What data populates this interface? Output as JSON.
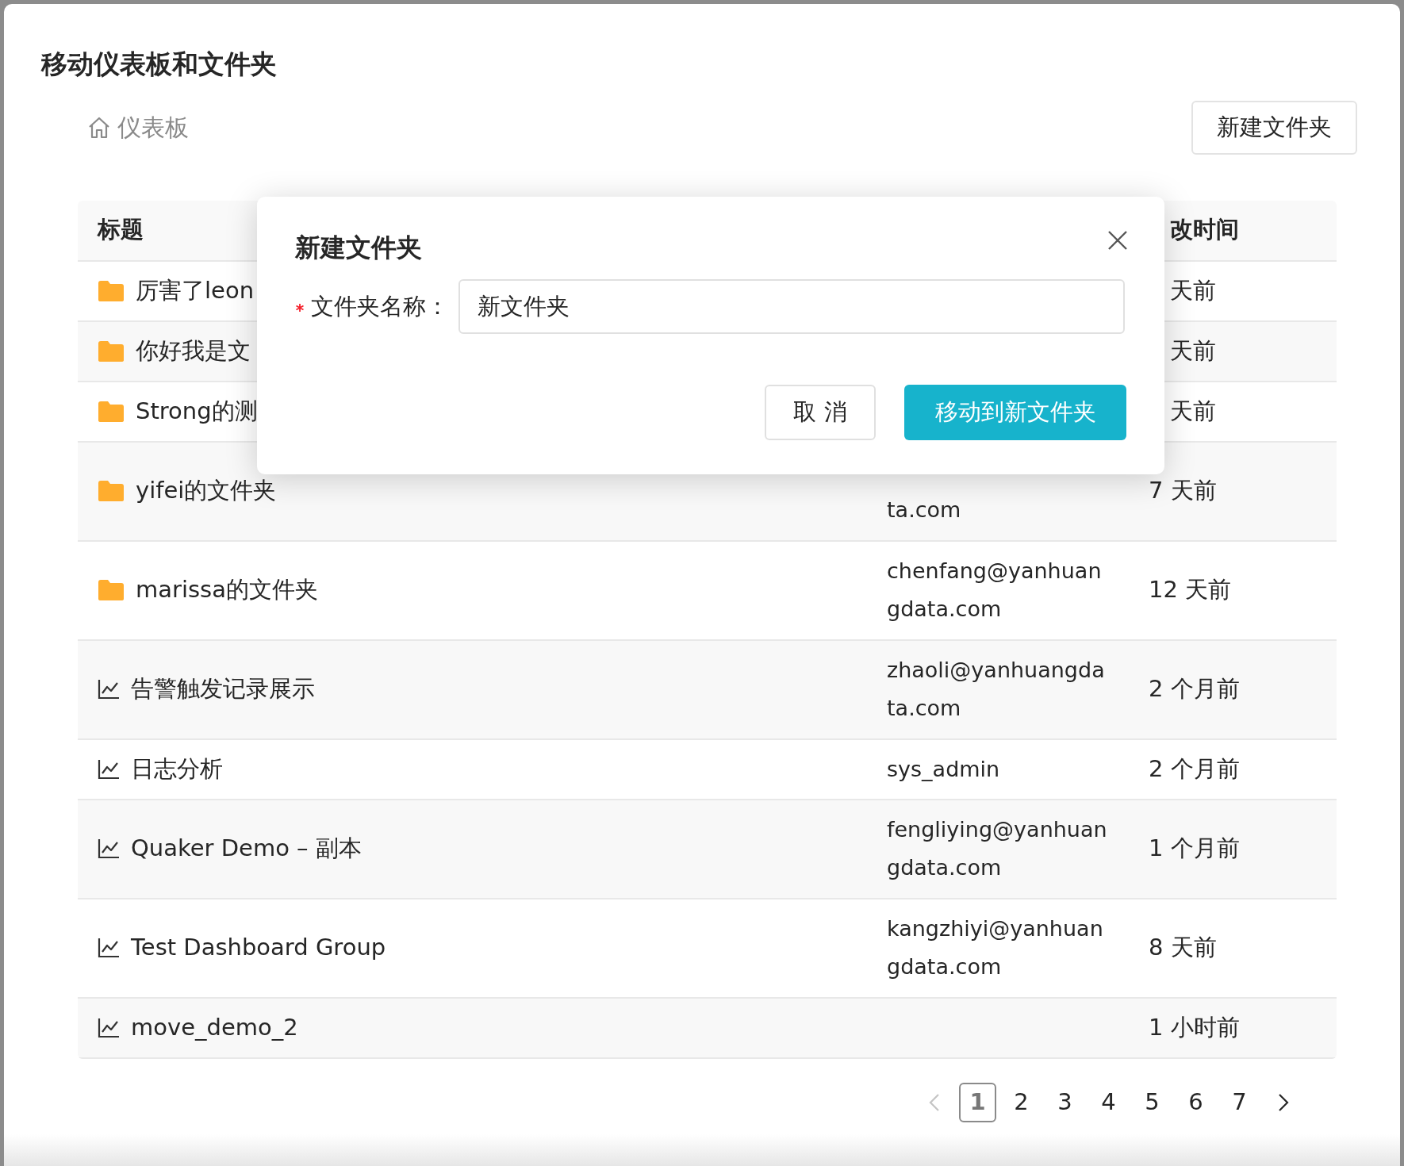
{
  "page": {
    "title": "移动仪表板和文件夹",
    "breadcrumb": "仪表板",
    "new_folder_button": "新建文件夹"
  },
  "table": {
    "header_col_1": "标题",
    "header_col_3": "改时间",
    "header_col_3_covered": true,
    "rows": [
      {
        "kind": "folder",
        "title": "厉害了leon",
        "time": "天前",
        "time_covered": true
      },
      {
        "kind": "folder",
        "title": "你好我是文",
        "time": "天前",
        "time_covered": true
      },
      {
        "kind": "folder",
        "title": "Strong的测",
        "time": "天前",
        "time_covered": true
      },
      {
        "kind": "folder",
        "title": "yifei的文件夹",
        "owner": "ta.com",
        "owner_covered": true,
        "time": "7 天前"
      },
      {
        "kind": "folder",
        "title": "marissa的文件夹",
        "owner": "chenfang@yanhuangdata.com",
        "time": "12 天前"
      },
      {
        "kind": "dashboard",
        "title": "告警触发记录展示",
        "owner": "zhaoli@yanhuangdata.com",
        "time": "2 个月前"
      },
      {
        "kind": "dashboard",
        "title": "日志分析",
        "owner": "sys_admin",
        "time": "2 个月前"
      },
      {
        "kind": "dashboard",
        "title": "Quaker Demo – 副本",
        "owner": "fengliying@yanhuangdata.com",
        "time": "1 个月前"
      },
      {
        "kind": "dashboard",
        "title": "Test Dashboard Group",
        "owner": "kangzhiyi@yanhuangdata.com",
        "time": "8 天前"
      },
      {
        "kind": "dashboard",
        "title": "move_demo_2",
        "time": "1 小时前"
      }
    ]
  },
  "pagination": {
    "prev_disabled": true,
    "next_disabled": false,
    "pages": [
      {
        "label": "1",
        "selected": true
      },
      {
        "label": "2",
        "selected": false
      },
      {
        "label": "3",
        "selected": false
      },
      {
        "label": "4",
        "selected": false
      },
      {
        "label": "5",
        "selected": false
      },
      {
        "label": "6",
        "selected": false
      },
      {
        "label": "7",
        "selected": false
      }
    ]
  },
  "dialog": {
    "title": "新建文件夹",
    "field_label": "文件夹名称：",
    "required": true,
    "field_value": "新文件夹",
    "cancel_button": "取 消",
    "confirm_button": "移动到新文件夹"
  }
}
